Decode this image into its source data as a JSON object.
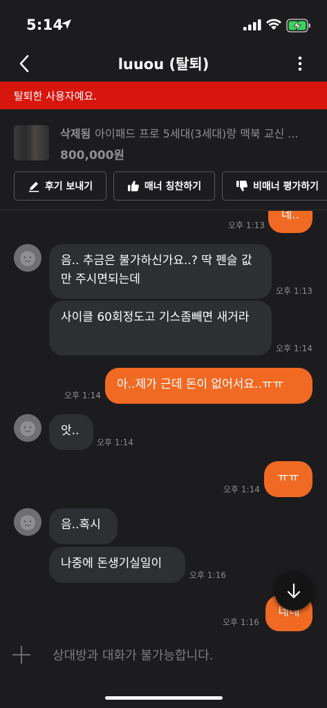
{
  "status_bar": {
    "time": "5:14"
  },
  "nav": {
    "title": "luuou (탈퇴)"
  },
  "alert": {
    "text": "탈퇴한 사용자예요."
  },
  "product": {
    "status": "삭제됨",
    "name": "아이패드 프로 5세대(3세대)랑 맥북 교신 ...",
    "price": "800,000원"
  },
  "actions": {
    "review": "후기 보내기",
    "praise": "매너 칭찬하기",
    "report": "비매너 평가하기"
  },
  "messages": [
    {
      "side": "out",
      "text": "네..",
      "time": "오후 1:13"
    },
    {
      "side": "in",
      "text": "음.. 추금은 불가하신가요..? 딱 펜슬 값만 주시면되는데",
      "time": "오후 1:13"
    },
    {
      "side": "in",
      "text": "사이클 60회정도고 기스좀빼면 새거라",
      "time": "오후 1:14"
    },
    {
      "side": "out",
      "text": "아..제가 근데 돈이 없어서요..ㅠㅠ",
      "time": "오후 1:14"
    },
    {
      "side": "in",
      "text": "앗..",
      "time": "오후 1:14"
    },
    {
      "side": "out",
      "text": "ㅠㅠ",
      "time": "오후 1:14"
    },
    {
      "side": "in",
      "text": "음..혹시",
      "time": ""
    },
    {
      "side": "in",
      "text": "나중에 돈생기실일이",
      "time": "오후 1:16"
    },
    {
      "side": "out",
      "text": "네네",
      "time": "오후 1:16"
    }
  ],
  "input": {
    "placeholder": "상대방과 대화가 불가능합니다."
  },
  "colors": {
    "accent": "#f06a24",
    "alert": "#d6160f",
    "background": "#1c1c1e",
    "incoming_bubble": "#2d2f33"
  },
  "icons": [
    "location-arrow-icon",
    "signal-icon",
    "wifi-icon",
    "battery-charging-icon",
    "back-chevron-icon",
    "more-vertical-icon",
    "pencil-icon",
    "thumbs-up-icon",
    "thumbs-down-icon",
    "avatar-face-icon",
    "plus-icon",
    "arrow-down-icon"
  ]
}
